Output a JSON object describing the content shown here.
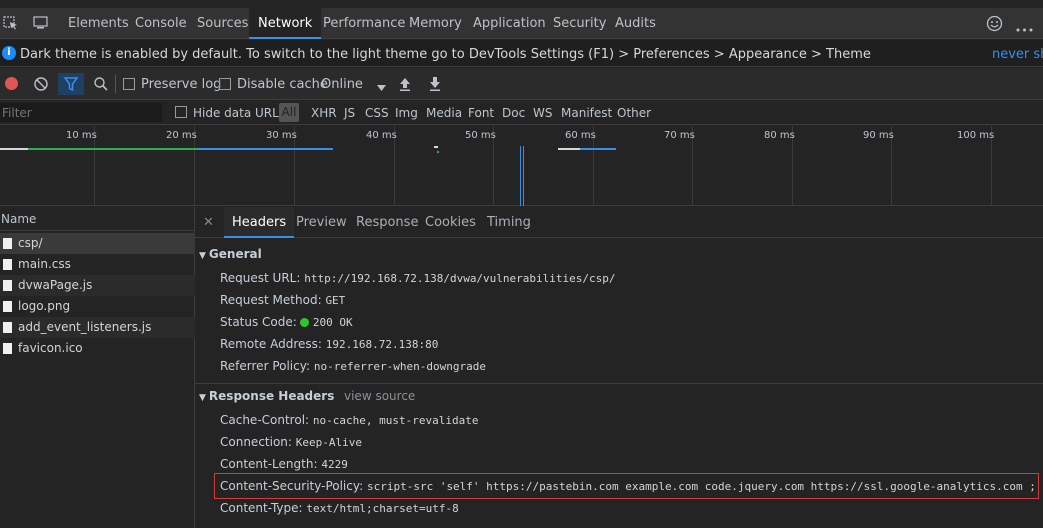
{
  "topbar": {
    "tabs": [
      "Elements",
      "Console",
      "Sources",
      "Network",
      "Performance",
      "Memory",
      "Application",
      "Security",
      "Audits"
    ],
    "active_tab": "Network",
    "icons": [
      "inspect-element-icon",
      "device-toolbar-icon",
      "feedback-smiley-icon",
      "more-options-icon"
    ]
  },
  "banner": {
    "message": "Dark theme is enabled by default. To switch to the light theme go to DevTools Settings (F1) > Preferences > Appearance > Theme",
    "link": "never sho"
  },
  "toolbar": {
    "preserve_log": "Preserve log",
    "disable_cache": "Disable cache",
    "throttle": "Online"
  },
  "filterbar": {
    "placeholder": "Filter",
    "hide_data_urls": "Hide data URLs",
    "all": "All",
    "types": [
      "XHR",
      "JS",
      "CSS",
      "Img",
      "Media",
      "Font",
      "Doc",
      "WS",
      "Manifest",
      "Other"
    ]
  },
  "overview": {
    "ticks": [
      "10 ms",
      "20 ms",
      "30 ms",
      "40 ms",
      "50 ms",
      "60 ms",
      "70 ms",
      "80 ms",
      "90 ms",
      "100 ms"
    ]
  },
  "requests": {
    "header": "Name",
    "items": [
      "csp/",
      "main.css",
      "dvwaPage.js",
      "logo.png",
      "add_event_listeners.js",
      "favicon.ico"
    ]
  },
  "details": {
    "tabs": [
      "Headers",
      "Preview",
      "Response",
      "Cookies",
      "Timing"
    ],
    "active_tab": "Headers",
    "general": {
      "title": "General",
      "rows": [
        {
          "key": "Request URL:",
          "value": "http://192.168.72.138/dvwa/vulnerabilities/csp/"
        },
        {
          "key": "Request Method:",
          "value": "GET"
        },
        {
          "key": "Status Code:",
          "value": "200 OK"
        },
        {
          "key": "Remote Address:",
          "value": "192.168.72.138:80"
        },
        {
          "key": "Referrer Policy:",
          "value": "no-referrer-when-downgrade"
        }
      ]
    },
    "response_headers": {
      "title": "Response Headers",
      "view_source": "view source",
      "rows": [
        {
          "key": "Cache-Control:",
          "value": "no-cache, must-revalidate"
        },
        {
          "key": "Connection:",
          "value": "Keep-Alive"
        },
        {
          "key": "Content-Length:",
          "value": "4229"
        },
        {
          "key": "Content-Security-Policy:",
          "value": "script-src 'self' https://pastebin.com  example.com code.jquery.com https://ssl.google-analytics.com ;"
        },
        {
          "key": "Content-Type:",
          "value": "text/html;charset=utf-8"
        }
      ]
    }
  },
  "colors": {
    "accent": "#3a8ee6",
    "record": "#e05556",
    "status_ok": "#2fc52f",
    "highlight_box": "#d43b3b"
  }
}
